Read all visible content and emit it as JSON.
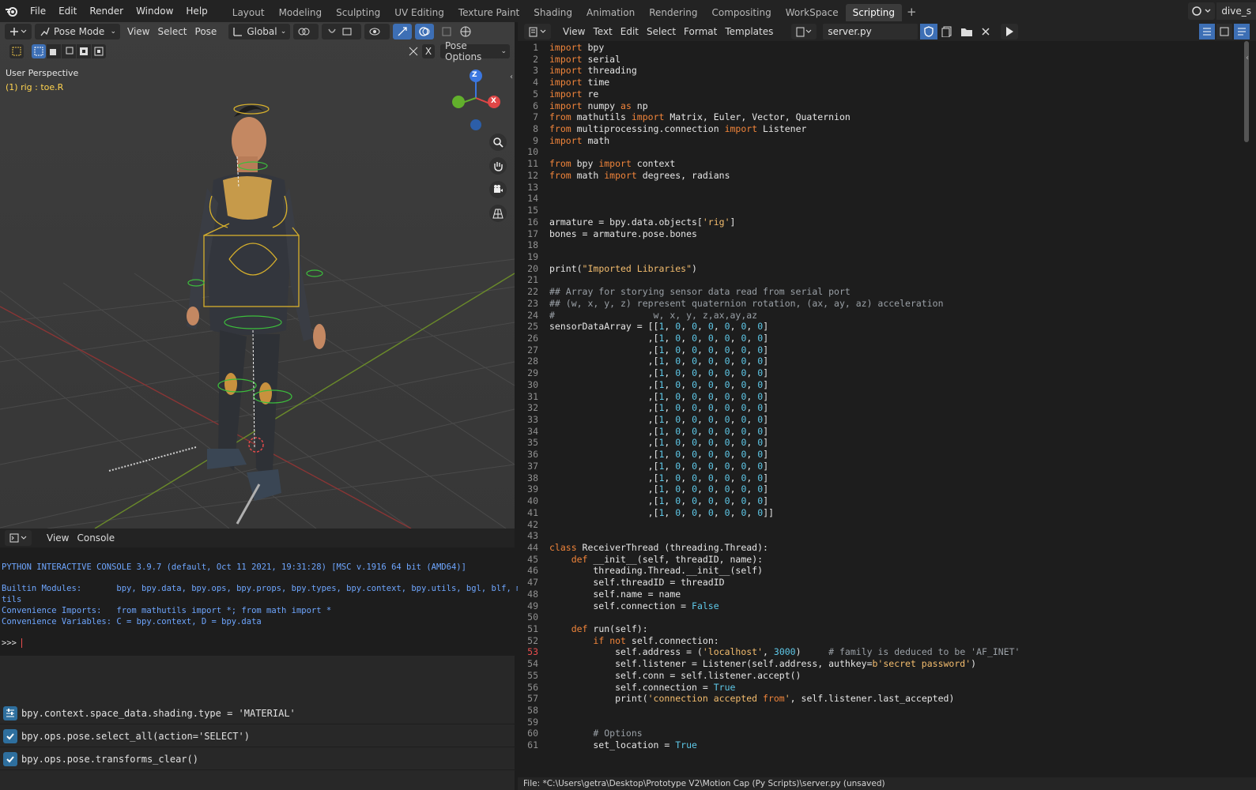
{
  "menu": {
    "file": "File",
    "edit": "Edit",
    "render": "Render",
    "window": "Window",
    "help": "Help"
  },
  "workspaces": [
    "Layout",
    "Modeling",
    "Sculpting",
    "UV Editing",
    "Texture Paint",
    "Shading",
    "Animation",
    "Rendering",
    "Compositing",
    "WorkSpace",
    "Scripting"
  ],
  "active_workspace": "Scripting",
  "scene_name": "dive_s",
  "viewport": {
    "mode": "Pose Mode",
    "menus": [
      "View",
      "Select",
      "Pose"
    ],
    "transform": "Global",
    "pose_options": "Pose Options",
    "x_label": "X",
    "perspective": "User Perspective",
    "selection": "(1) rig : toe.R",
    "gizmo": {
      "z": "Z",
      "y": "Y",
      "x": "X"
    }
  },
  "console": {
    "menus": [
      "View",
      "Console"
    ],
    "banner": "PYTHON INTERACTIVE CONSOLE 3.9.7 (default, Oct 11 2021, 19:31:28) [MSC v.1916 64 bit (AMD64)]",
    "builtin_label": "Builtin Modules:       bpy, bpy.data, bpy.ops, bpy.props, bpy.types, bpy.context, bpy.utils, bgl, blf, mathu",
    "builtin_cont": "tils",
    "imports": "Convenience Imports:   from mathutils import *; from math import *",
    "variables": "Convenience Variables: C = bpy.context, D = bpy.data",
    "prompt": ">>> "
  },
  "info_log": [
    "bpy.context.space_data.shading.type = 'MATERIAL'",
    "bpy.ops.pose.select_all(action='SELECT')",
    "bpy.ops.pose.transforms_clear()"
  ],
  "editor": {
    "menus": [
      "View",
      "Text",
      "Edit",
      "Select",
      "Format",
      "Templates"
    ],
    "filename": "server.py",
    "status": "File: *C:\\Users\\getra\\Desktop\\Prototype V2\\Motion Cap (Py Scripts)\\server.py (unsaved)",
    "current_line": 53,
    "lines": [
      "import bpy",
      "import serial",
      "import threading",
      "import time",
      "import re",
      "import numpy as np",
      "from mathutils import Matrix, Euler, Vector, Quaternion",
      "from multiprocessing.connection import Listener",
      "import math",
      "",
      "from bpy import context",
      "from math import degrees, radians",
      "",
      "",
      "",
      "armature = bpy.data.objects['rig']",
      "bones = armature.pose.bones",
      "",
      "",
      "print(\"Imported Libraries\")",
      "",
      "## Array for storying sensor data read from serial port",
      "## (w, x, y, z) represent quaternion rotation, (ax, ay, az) acceleration",
      "#                  w, x, y, z,ax,ay,az",
      "sensorDataArray = [[1, 0, 0, 0, 0, 0, 0]",
      "                  ,[1, 0, 0, 0, 0, 0, 0]",
      "                  ,[1, 0, 0, 0, 0, 0, 0]",
      "                  ,[1, 0, 0, 0, 0, 0, 0]",
      "                  ,[1, 0, 0, 0, 0, 0, 0]",
      "                  ,[1, 0, 0, 0, 0, 0, 0]",
      "                  ,[1, 0, 0, 0, 0, 0, 0]",
      "                  ,[1, 0, 0, 0, 0, 0, 0]",
      "                  ,[1, 0, 0, 0, 0, 0, 0]",
      "                  ,[1, 0, 0, 0, 0, 0, 0]",
      "                  ,[1, 0, 0, 0, 0, 0, 0]",
      "                  ,[1, 0, 0, 0, 0, 0, 0]",
      "                  ,[1, 0, 0, 0, 0, 0, 0]",
      "                  ,[1, 0, 0, 0, 0, 0, 0]",
      "                  ,[1, 0, 0, 0, 0, 0, 0]",
      "                  ,[1, 0, 0, 0, 0, 0, 0]",
      "                  ,[1, 0, 0, 0, 0, 0, 0]]",
      "",
      "",
      "class ReceiverThread (threading.Thread):",
      "    def __init__(self, threadID, name):",
      "        threading.Thread.__init__(self)",
      "        self.threadID = threadID",
      "        self.name = name",
      "        self.connection = False",
      "",
      "    def run(self):",
      "        if not self.connection:",
      "            self.address = ('localhost', 3000)     # family is deduced to be 'AF_INET'",
      "            self.listener = Listener(self.address, authkey=b'secret password')",
      "            self.conn = self.listener.accept()",
      "            self.connection = True",
      "            print('connection accepted from', self.listener.last_accepted)",
      "",
      "",
      "        # Options",
      "        set_location = True"
    ]
  },
  "colors": {
    "keyword": "#f0843a",
    "string": "#f4bd6e",
    "number": "#5ec8e8",
    "comment": "#9aa0a6",
    "selected_text": "#ffd44f",
    "console_text": "#6ea6ff"
  }
}
